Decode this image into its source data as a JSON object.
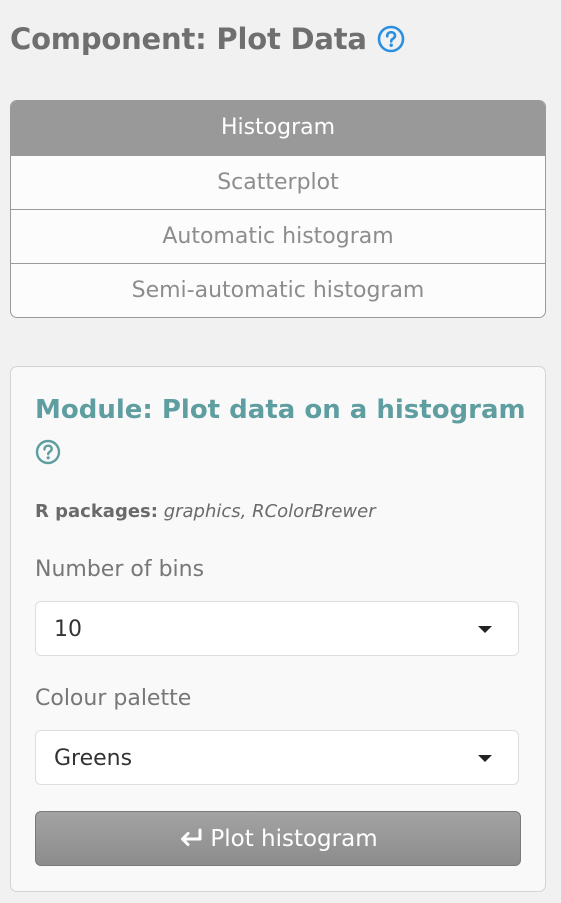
{
  "component": {
    "title": "Component: Plot Data",
    "help_icon": "question-circle-icon"
  },
  "tabs": [
    {
      "label": "Histogram",
      "active": true
    },
    {
      "label": "Scatterplot",
      "active": false
    },
    {
      "label": "Automatic histogram",
      "active": false
    },
    {
      "label": "Semi-automatic histogram",
      "active": false
    }
  ],
  "module": {
    "title": "Module: Plot data on a histogram",
    "help_icon": "question-circle-icon",
    "packages_label": "R packages:",
    "packages_list": "graphics, RColorBrewer",
    "bins": {
      "label": "Number of bins",
      "value": "10"
    },
    "palette": {
      "label": "Colour palette",
      "value": "Greens"
    },
    "plot_button": {
      "label": "Plot histogram",
      "icon": "enter-arrow-icon"
    }
  },
  "colors": {
    "component_title": "#6f6f6f",
    "help_icon_blue": "#2a8fe0",
    "module_title": "#5f9ea0",
    "active_tab_bg": "#999999",
    "button_bg": "#959595"
  }
}
